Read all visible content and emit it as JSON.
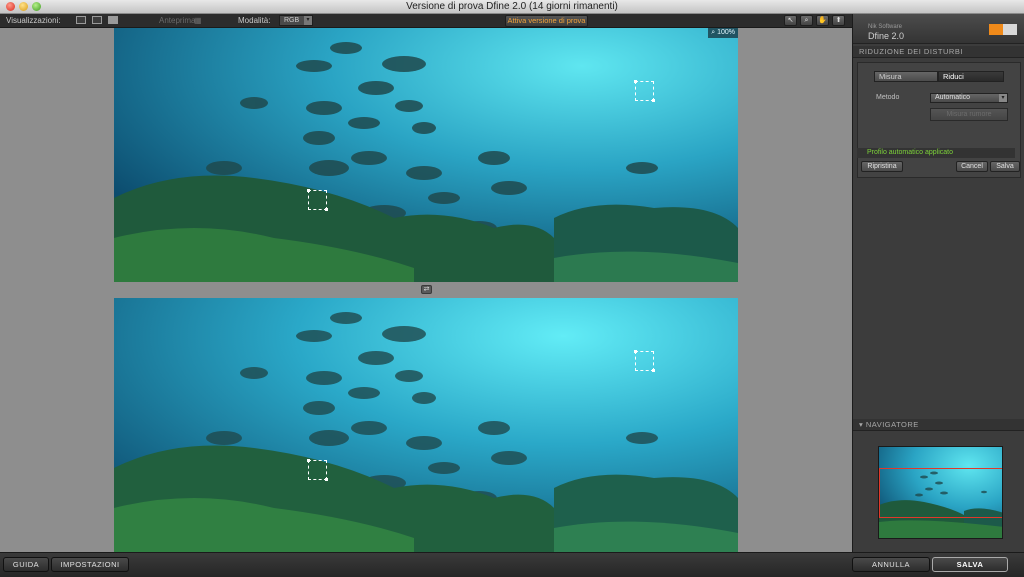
{
  "window": {
    "title": "Versione di prova Dfine 2.0 (14 giorni rimanenti)"
  },
  "toolbar": {
    "views_label": "Visualizzazioni:",
    "before_label": "Anteprima",
    "mode_label": "Modalità:",
    "mode_value": "RGB",
    "activate_label": "Attiva versione di prova",
    "tools": [
      "arrow-icon",
      "zoom-icon",
      "hand-icon",
      "info-icon"
    ]
  },
  "preview": {
    "zoom": "100%"
  },
  "panel": {
    "brand_small": "Nik Software",
    "product": "Dfine 2.0",
    "noise_section": "RIDUZIONE DEI DISTURBI",
    "tab_measure": "Misura",
    "tab_reduce": "Riduci",
    "method_label": "Metodo",
    "method_value": "Automatico",
    "measure_noise_button": "Misura rumore",
    "status": "Profilo automatico applicato",
    "reset_button": "Ripristina",
    "clear_button": "Cancel",
    "save_button": "Salva",
    "navigator_section": "NAVIGATORE"
  },
  "bottom": {
    "help": "GUIDA",
    "settings": "IMPOSTAZIONI",
    "cancel": "ANNULLA",
    "save": "SALVA"
  }
}
